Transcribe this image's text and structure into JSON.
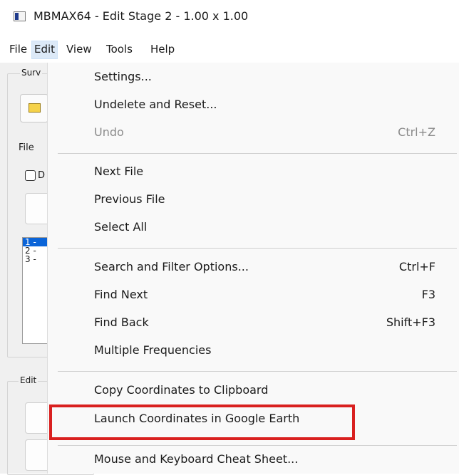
{
  "window": {
    "title": "MBMAX64 - Edit Stage 2 - 1.00 x 1.00"
  },
  "menubar": {
    "items": [
      "File",
      "Edit",
      "View",
      "Tools",
      "Help"
    ],
    "active": "Edit"
  },
  "background": {
    "survey_group_label": "Surv",
    "file_label": "File",
    "checkbox_label": "D",
    "list_items": [
      "1 -",
      "2 -",
      "3 -"
    ],
    "edit_group_label": "Edit"
  },
  "edit_menu": {
    "settings": {
      "label": "Settings..."
    },
    "undelete_reset": {
      "label": "Undelete and Reset..."
    },
    "undo": {
      "label": "Undo",
      "shortcut": "Ctrl+Z",
      "enabled": false
    },
    "next_file": {
      "label": "Next File"
    },
    "previous_file": {
      "label": "Previous File"
    },
    "select_all": {
      "label": "Select All"
    },
    "search_filter": {
      "label": "Search and Filter Options...",
      "shortcut": "Ctrl+F"
    },
    "find_next": {
      "label": "Find Next",
      "shortcut": "F3"
    },
    "find_back": {
      "label": "Find Back",
      "shortcut": "Shift+F3"
    },
    "multiple_frequencies": {
      "label": "Multiple Frequencies"
    },
    "copy_coordinates": {
      "label": "Copy Coordinates to Clipboard"
    },
    "launch_google_earth": {
      "label": "Launch Coordinates in Google Earth",
      "highlighted": true
    },
    "cheat_sheet": {
      "label": "Mouse and Keyboard Cheat Sheet..."
    }
  },
  "colors": {
    "highlight_border": "#d9201f",
    "menu_background": "#f9f9f9",
    "active_menu": "#dce9f7",
    "list_selection": "#0a64d8"
  }
}
